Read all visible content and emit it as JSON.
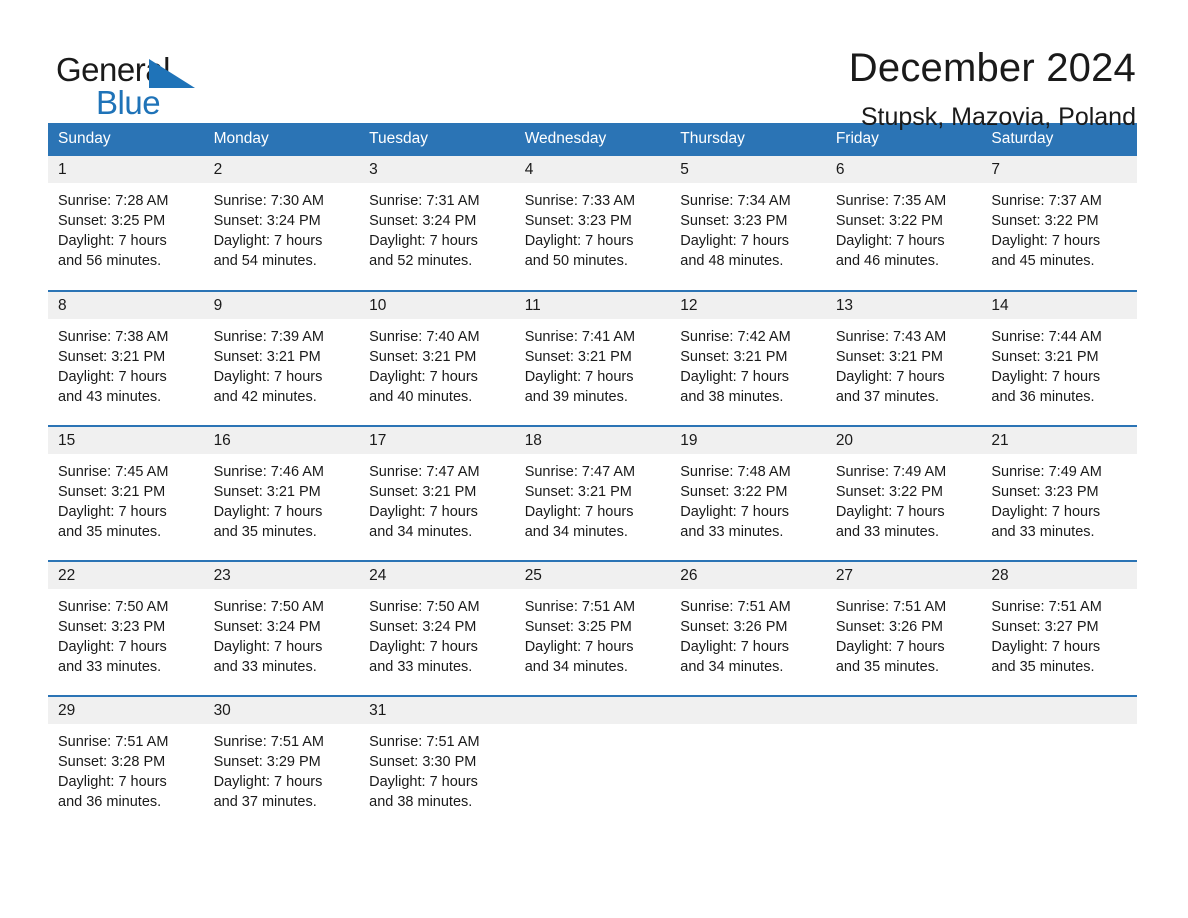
{
  "brand": {
    "name_part1": "General",
    "name_part2": "Blue",
    "triangle_color": "#1f73b8"
  },
  "header": {
    "title": "December 2024",
    "subtitle": "Stupsk, Mazovia, Poland"
  },
  "theme": {
    "header_blue": "#2b74b5",
    "daynum_gray": "#f0f0f0",
    "text": "#1a1a1a",
    "page_bg": "#ffffff"
  },
  "weekday_headers": [
    "Sunday",
    "Monday",
    "Tuesday",
    "Wednesday",
    "Thursday",
    "Friday",
    "Saturday"
  ],
  "weeks": [
    [
      {
        "day": "1",
        "sunrise": "Sunrise: 7:28 AM",
        "sunset": "Sunset: 3:25 PM",
        "daylight1": "Daylight: 7 hours",
        "daylight2": "and 56 minutes."
      },
      {
        "day": "2",
        "sunrise": "Sunrise: 7:30 AM",
        "sunset": "Sunset: 3:24 PM",
        "daylight1": "Daylight: 7 hours",
        "daylight2": "and 54 minutes."
      },
      {
        "day": "3",
        "sunrise": "Sunrise: 7:31 AM",
        "sunset": "Sunset: 3:24 PM",
        "daylight1": "Daylight: 7 hours",
        "daylight2": "and 52 minutes."
      },
      {
        "day": "4",
        "sunrise": "Sunrise: 7:33 AM",
        "sunset": "Sunset: 3:23 PM",
        "daylight1": "Daylight: 7 hours",
        "daylight2": "and 50 minutes."
      },
      {
        "day": "5",
        "sunrise": "Sunrise: 7:34 AM",
        "sunset": "Sunset: 3:23 PM",
        "daylight1": "Daylight: 7 hours",
        "daylight2": "and 48 minutes."
      },
      {
        "day": "6",
        "sunrise": "Sunrise: 7:35 AM",
        "sunset": "Sunset: 3:22 PM",
        "daylight1": "Daylight: 7 hours",
        "daylight2": "and 46 minutes."
      },
      {
        "day": "7",
        "sunrise": "Sunrise: 7:37 AM",
        "sunset": "Sunset: 3:22 PM",
        "daylight1": "Daylight: 7 hours",
        "daylight2": "and 45 minutes."
      }
    ],
    [
      {
        "day": "8",
        "sunrise": "Sunrise: 7:38 AM",
        "sunset": "Sunset: 3:21 PM",
        "daylight1": "Daylight: 7 hours",
        "daylight2": "and 43 minutes."
      },
      {
        "day": "9",
        "sunrise": "Sunrise: 7:39 AM",
        "sunset": "Sunset: 3:21 PM",
        "daylight1": "Daylight: 7 hours",
        "daylight2": "and 42 minutes."
      },
      {
        "day": "10",
        "sunrise": "Sunrise: 7:40 AM",
        "sunset": "Sunset: 3:21 PM",
        "daylight1": "Daylight: 7 hours",
        "daylight2": "and 40 minutes."
      },
      {
        "day": "11",
        "sunrise": "Sunrise: 7:41 AM",
        "sunset": "Sunset: 3:21 PM",
        "daylight1": "Daylight: 7 hours",
        "daylight2": "and 39 minutes."
      },
      {
        "day": "12",
        "sunrise": "Sunrise: 7:42 AM",
        "sunset": "Sunset: 3:21 PM",
        "daylight1": "Daylight: 7 hours",
        "daylight2": "and 38 minutes."
      },
      {
        "day": "13",
        "sunrise": "Sunrise: 7:43 AM",
        "sunset": "Sunset: 3:21 PM",
        "daylight1": "Daylight: 7 hours",
        "daylight2": "and 37 minutes."
      },
      {
        "day": "14",
        "sunrise": "Sunrise: 7:44 AM",
        "sunset": "Sunset: 3:21 PM",
        "daylight1": "Daylight: 7 hours",
        "daylight2": "and 36 minutes."
      }
    ],
    [
      {
        "day": "15",
        "sunrise": "Sunrise: 7:45 AM",
        "sunset": "Sunset: 3:21 PM",
        "daylight1": "Daylight: 7 hours",
        "daylight2": "and 35 minutes."
      },
      {
        "day": "16",
        "sunrise": "Sunrise: 7:46 AM",
        "sunset": "Sunset: 3:21 PM",
        "daylight1": "Daylight: 7 hours",
        "daylight2": "and 35 minutes."
      },
      {
        "day": "17",
        "sunrise": "Sunrise: 7:47 AM",
        "sunset": "Sunset: 3:21 PM",
        "daylight1": "Daylight: 7 hours",
        "daylight2": "and 34 minutes."
      },
      {
        "day": "18",
        "sunrise": "Sunrise: 7:47 AM",
        "sunset": "Sunset: 3:21 PM",
        "daylight1": "Daylight: 7 hours",
        "daylight2": "and 34 minutes."
      },
      {
        "day": "19",
        "sunrise": "Sunrise: 7:48 AM",
        "sunset": "Sunset: 3:22 PM",
        "daylight1": "Daylight: 7 hours",
        "daylight2": "and 33 minutes."
      },
      {
        "day": "20",
        "sunrise": "Sunrise: 7:49 AM",
        "sunset": "Sunset: 3:22 PM",
        "daylight1": "Daylight: 7 hours",
        "daylight2": "and 33 minutes."
      },
      {
        "day": "21",
        "sunrise": "Sunrise: 7:49 AM",
        "sunset": "Sunset: 3:23 PM",
        "daylight1": "Daylight: 7 hours",
        "daylight2": "and 33 minutes."
      }
    ],
    [
      {
        "day": "22",
        "sunrise": "Sunrise: 7:50 AM",
        "sunset": "Sunset: 3:23 PM",
        "daylight1": "Daylight: 7 hours",
        "daylight2": "and 33 minutes."
      },
      {
        "day": "23",
        "sunrise": "Sunrise: 7:50 AM",
        "sunset": "Sunset: 3:24 PM",
        "daylight1": "Daylight: 7 hours",
        "daylight2": "and 33 minutes."
      },
      {
        "day": "24",
        "sunrise": "Sunrise: 7:50 AM",
        "sunset": "Sunset: 3:24 PM",
        "daylight1": "Daylight: 7 hours",
        "daylight2": "and 33 minutes."
      },
      {
        "day": "25",
        "sunrise": "Sunrise: 7:51 AM",
        "sunset": "Sunset: 3:25 PM",
        "daylight1": "Daylight: 7 hours",
        "daylight2": "and 34 minutes."
      },
      {
        "day": "26",
        "sunrise": "Sunrise: 7:51 AM",
        "sunset": "Sunset: 3:26 PM",
        "daylight1": "Daylight: 7 hours",
        "daylight2": "and 34 minutes."
      },
      {
        "day": "27",
        "sunrise": "Sunrise: 7:51 AM",
        "sunset": "Sunset: 3:26 PM",
        "daylight1": "Daylight: 7 hours",
        "daylight2": "and 35 minutes."
      },
      {
        "day": "28",
        "sunrise": "Sunrise: 7:51 AM",
        "sunset": "Sunset: 3:27 PM",
        "daylight1": "Daylight: 7 hours",
        "daylight2": "and 35 minutes."
      }
    ],
    [
      {
        "day": "29",
        "sunrise": "Sunrise: 7:51 AM",
        "sunset": "Sunset: 3:28 PM",
        "daylight1": "Daylight: 7 hours",
        "daylight2": "and 36 minutes."
      },
      {
        "day": "30",
        "sunrise": "Sunrise: 7:51 AM",
        "sunset": "Sunset: 3:29 PM",
        "daylight1": "Daylight: 7 hours",
        "daylight2": "and 37 minutes."
      },
      {
        "day": "31",
        "sunrise": "Sunrise: 7:51 AM",
        "sunset": "Sunset: 3:30 PM",
        "daylight1": "Daylight: 7 hours",
        "daylight2": "and 38 minutes."
      },
      {
        "day": "",
        "sunrise": "",
        "sunset": "",
        "daylight1": "",
        "daylight2": ""
      },
      {
        "day": "",
        "sunrise": "",
        "sunset": "",
        "daylight1": "",
        "daylight2": ""
      },
      {
        "day": "",
        "sunrise": "",
        "sunset": "",
        "daylight1": "",
        "daylight2": ""
      },
      {
        "day": "",
        "sunrise": "",
        "sunset": "",
        "daylight1": "",
        "daylight2": ""
      }
    ]
  ]
}
